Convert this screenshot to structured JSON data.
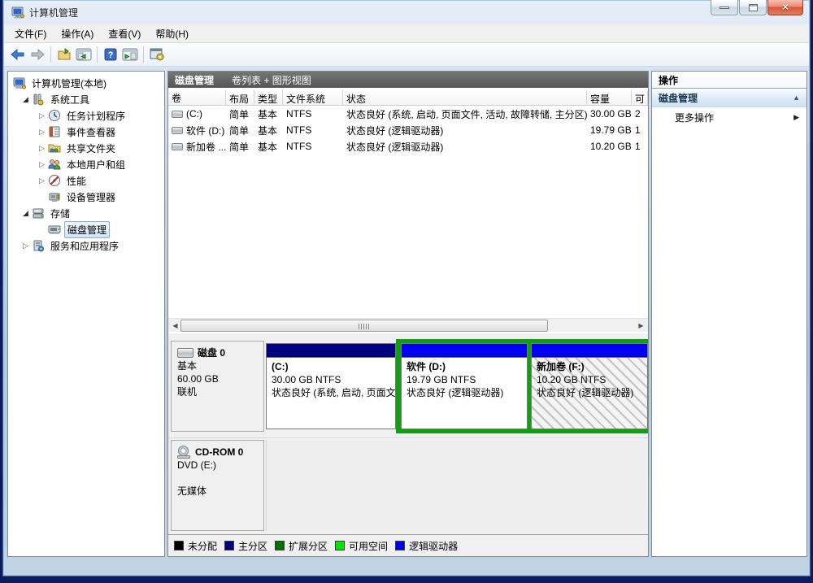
{
  "window": {
    "title": "计算机管理"
  },
  "menu": {
    "items": [
      "文件(F)",
      "操作(A)",
      "查看(V)",
      "帮助(H)"
    ]
  },
  "tree": {
    "items": [
      {
        "label": "计算机管理(本地)"
      },
      {
        "label": "系统工具"
      },
      {
        "label": "任务计划程序"
      },
      {
        "label": "事件查看器"
      },
      {
        "label": "共享文件夹"
      },
      {
        "label": "本地用户和组"
      },
      {
        "label": "性能"
      },
      {
        "label": "设备管理器"
      },
      {
        "label": "存储"
      },
      {
        "label": "磁盘管理"
      },
      {
        "label": "服务和应用程序"
      }
    ]
  },
  "main": {
    "header": {
      "title": "磁盘管理",
      "subtitle": "卷列表 + 图形视图"
    },
    "table": {
      "columns": [
        "卷",
        "布局",
        "类型",
        "文件系统",
        "状态",
        "容量",
        "可"
      ],
      "rows": [
        {
          "volume": "(C:)",
          "layout": "简单",
          "type": "基本",
          "fs": "NTFS",
          "status": "状态良好 (系统, 启动, 页面文件, 活动, 故障转储, 主分区)",
          "capacity": "30.00 GB",
          "free": "2"
        },
        {
          "volume": "软件 (D:)",
          "layout": "简单",
          "type": "基本",
          "fs": "NTFS",
          "status": "状态良好 (逻辑驱动器)",
          "capacity": "19.79 GB",
          "free": "1"
        },
        {
          "volume": "新加卷 ...",
          "layout": "简单",
          "type": "基本",
          "fs": "NTFS",
          "status": "状态良好 (逻辑驱动器)",
          "capacity": "10.20 GB",
          "free": "1"
        }
      ]
    },
    "disk0": {
      "name": "磁盘 0",
      "type": "基本",
      "size": "60.00 GB",
      "status": "联机",
      "partitions": [
        {
          "label": "(C:)",
          "size": "30.00 GB NTFS",
          "status": "状态良好 (系统, 启动, 页面文",
          "bar_color": "#000080"
        },
        {
          "label": "软件  (D:)",
          "size": "19.79 GB NTFS",
          "status": "状态良好 (逻辑驱动器)",
          "bar_color": "#0000f0"
        },
        {
          "label": "新加卷  (F:)",
          "size": "10.20 GB NTFS",
          "status": "状态良好 (逻辑驱动器)",
          "bar_color": "#0000f0"
        }
      ]
    },
    "cdrom": {
      "name": "CD-ROM 0",
      "drive": "DVD (E:)",
      "media": "无媒体"
    },
    "legend": [
      {
        "label": "未分配",
        "color": "#000000"
      },
      {
        "label": "主分区",
        "color": "#000080"
      },
      {
        "label": "扩展分区",
        "color": "#007200"
      },
      {
        "label": "可用空间",
        "color": "#00e400"
      },
      {
        "label": "逻辑驱动器",
        "color": "#0000f0"
      }
    ]
  },
  "actions": {
    "title": "操作",
    "section": "磁盘管理",
    "more": "更多操作"
  },
  "colors": {
    "extended_border": "#0f9f0f",
    "primary_partition": "#000080",
    "logical_drive": "#0000f0"
  }
}
